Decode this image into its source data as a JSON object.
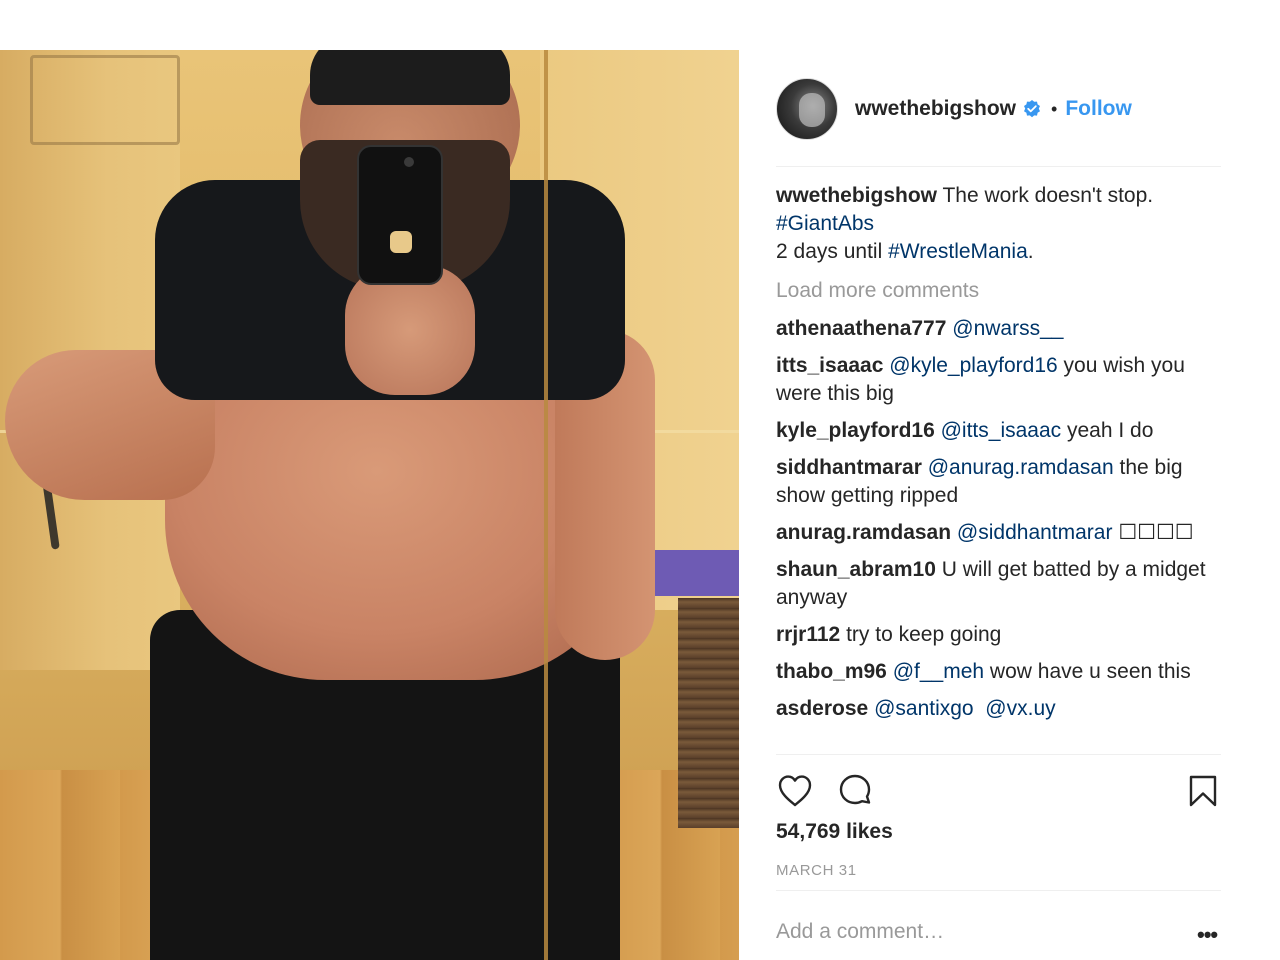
{
  "post": {
    "username": "wwethebigshow",
    "dot": "•",
    "follow_label": "Follow",
    "verified_icon": "verified-badge-icon",
    "caption": {
      "text_before": "The work doesn't stop.",
      "tag1": "#GiantAbs",
      "line2_prefix": "2 days until ",
      "tag2": "#WrestleMania",
      "line2_suffix": "."
    },
    "load_more": "Load more comments",
    "comments": [
      {
        "user": "athenaathena777",
        "mention": "@nwarss__",
        "text": ""
      },
      {
        "user": "itts_isaaac",
        "mention": "@kyle_playford16",
        "text": " you wish you were this big"
      },
      {
        "user": "kyle_playford16",
        "mention": "@itts_isaaac",
        "text": " yeah I do"
      },
      {
        "user": "siddhantmarar",
        "mention": "@anurag.ramdasan",
        "text": " the big show getting ripped"
      },
      {
        "user": "anurag.ramdasan",
        "mention": "@siddhantmarar",
        "text": " ☐☐☐☐"
      },
      {
        "user": "shaun_abram10",
        "mention": "",
        "text": "U will get batted by a midget anyway"
      },
      {
        "user": "rrjr112",
        "mention": "",
        "text": "try to keep going"
      },
      {
        "user": "thabo_m96",
        "mention": "@f__meh",
        "text": " wow have u seen this"
      },
      {
        "user": "asderose",
        "mention": "@santixgo",
        "text": "",
        "mention2": "@vx.uy"
      }
    ],
    "likes": "54,769 likes",
    "date": "MARCH 31",
    "add_comment_placeholder": "Add a comment…",
    "more_label": "•••",
    "icons": {
      "like": "heart-icon",
      "comment": "comment-bubble-icon",
      "save": "bookmark-icon"
    },
    "colors": {
      "link": "#3897f0",
      "hashtag": "#003569",
      "muted": "#999999",
      "text": "#262626"
    }
  }
}
